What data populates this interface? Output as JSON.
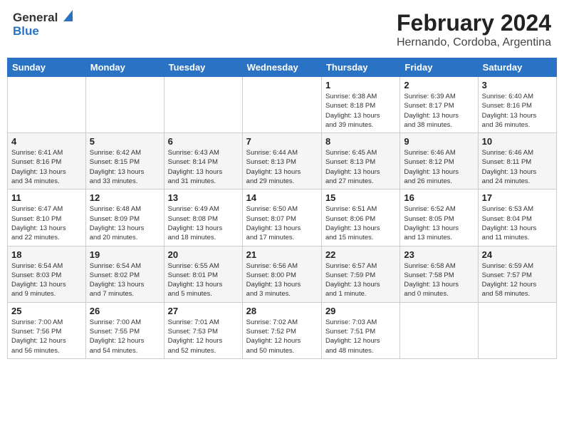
{
  "header": {
    "logo_general": "General",
    "logo_blue": "Blue",
    "title": "February 2024",
    "subtitle": "Hernando, Cordoba, Argentina"
  },
  "calendar": {
    "headers": [
      "Sunday",
      "Monday",
      "Tuesday",
      "Wednesday",
      "Thursday",
      "Friday",
      "Saturday"
    ],
    "weeks": [
      [
        {
          "num": "",
          "info": ""
        },
        {
          "num": "",
          "info": ""
        },
        {
          "num": "",
          "info": ""
        },
        {
          "num": "",
          "info": ""
        },
        {
          "num": "1",
          "info": "Sunrise: 6:38 AM\nSunset: 8:18 PM\nDaylight: 13 hours\nand 39 minutes."
        },
        {
          "num": "2",
          "info": "Sunrise: 6:39 AM\nSunset: 8:17 PM\nDaylight: 13 hours\nand 38 minutes."
        },
        {
          "num": "3",
          "info": "Sunrise: 6:40 AM\nSunset: 8:16 PM\nDaylight: 13 hours\nand 36 minutes."
        }
      ],
      [
        {
          "num": "4",
          "info": "Sunrise: 6:41 AM\nSunset: 8:16 PM\nDaylight: 13 hours\nand 34 minutes."
        },
        {
          "num": "5",
          "info": "Sunrise: 6:42 AM\nSunset: 8:15 PM\nDaylight: 13 hours\nand 33 minutes."
        },
        {
          "num": "6",
          "info": "Sunrise: 6:43 AM\nSunset: 8:14 PM\nDaylight: 13 hours\nand 31 minutes."
        },
        {
          "num": "7",
          "info": "Sunrise: 6:44 AM\nSunset: 8:13 PM\nDaylight: 13 hours\nand 29 minutes."
        },
        {
          "num": "8",
          "info": "Sunrise: 6:45 AM\nSunset: 8:13 PM\nDaylight: 13 hours\nand 27 minutes."
        },
        {
          "num": "9",
          "info": "Sunrise: 6:46 AM\nSunset: 8:12 PM\nDaylight: 13 hours\nand 26 minutes."
        },
        {
          "num": "10",
          "info": "Sunrise: 6:46 AM\nSunset: 8:11 PM\nDaylight: 13 hours\nand 24 minutes."
        }
      ],
      [
        {
          "num": "11",
          "info": "Sunrise: 6:47 AM\nSunset: 8:10 PM\nDaylight: 13 hours\nand 22 minutes."
        },
        {
          "num": "12",
          "info": "Sunrise: 6:48 AM\nSunset: 8:09 PM\nDaylight: 13 hours\nand 20 minutes."
        },
        {
          "num": "13",
          "info": "Sunrise: 6:49 AM\nSunset: 8:08 PM\nDaylight: 13 hours\nand 18 minutes."
        },
        {
          "num": "14",
          "info": "Sunrise: 6:50 AM\nSunset: 8:07 PM\nDaylight: 13 hours\nand 17 minutes."
        },
        {
          "num": "15",
          "info": "Sunrise: 6:51 AM\nSunset: 8:06 PM\nDaylight: 13 hours\nand 15 minutes."
        },
        {
          "num": "16",
          "info": "Sunrise: 6:52 AM\nSunset: 8:05 PM\nDaylight: 13 hours\nand 13 minutes."
        },
        {
          "num": "17",
          "info": "Sunrise: 6:53 AM\nSunset: 8:04 PM\nDaylight: 13 hours\nand 11 minutes."
        }
      ],
      [
        {
          "num": "18",
          "info": "Sunrise: 6:54 AM\nSunset: 8:03 PM\nDaylight: 13 hours\nand 9 minutes."
        },
        {
          "num": "19",
          "info": "Sunrise: 6:54 AM\nSunset: 8:02 PM\nDaylight: 13 hours\nand 7 minutes."
        },
        {
          "num": "20",
          "info": "Sunrise: 6:55 AM\nSunset: 8:01 PM\nDaylight: 13 hours\nand 5 minutes."
        },
        {
          "num": "21",
          "info": "Sunrise: 6:56 AM\nSunset: 8:00 PM\nDaylight: 13 hours\nand 3 minutes."
        },
        {
          "num": "22",
          "info": "Sunrise: 6:57 AM\nSunset: 7:59 PM\nDaylight: 13 hours\nand 1 minute."
        },
        {
          "num": "23",
          "info": "Sunrise: 6:58 AM\nSunset: 7:58 PM\nDaylight: 13 hours\nand 0 minutes."
        },
        {
          "num": "24",
          "info": "Sunrise: 6:59 AM\nSunset: 7:57 PM\nDaylight: 12 hours\nand 58 minutes."
        }
      ],
      [
        {
          "num": "25",
          "info": "Sunrise: 7:00 AM\nSunset: 7:56 PM\nDaylight: 12 hours\nand 56 minutes."
        },
        {
          "num": "26",
          "info": "Sunrise: 7:00 AM\nSunset: 7:55 PM\nDaylight: 12 hours\nand 54 minutes."
        },
        {
          "num": "27",
          "info": "Sunrise: 7:01 AM\nSunset: 7:53 PM\nDaylight: 12 hours\nand 52 minutes."
        },
        {
          "num": "28",
          "info": "Sunrise: 7:02 AM\nSunset: 7:52 PM\nDaylight: 12 hours\nand 50 minutes."
        },
        {
          "num": "29",
          "info": "Sunrise: 7:03 AM\nSunset: 7:51 PM\nDaylight: 12 hours\nand 48 minutes."
        },
        {
          "num": "",
          "info": ""
        },
        {
          "num": "",
          "info": ""
        }
      ]
    ]
  }
}
